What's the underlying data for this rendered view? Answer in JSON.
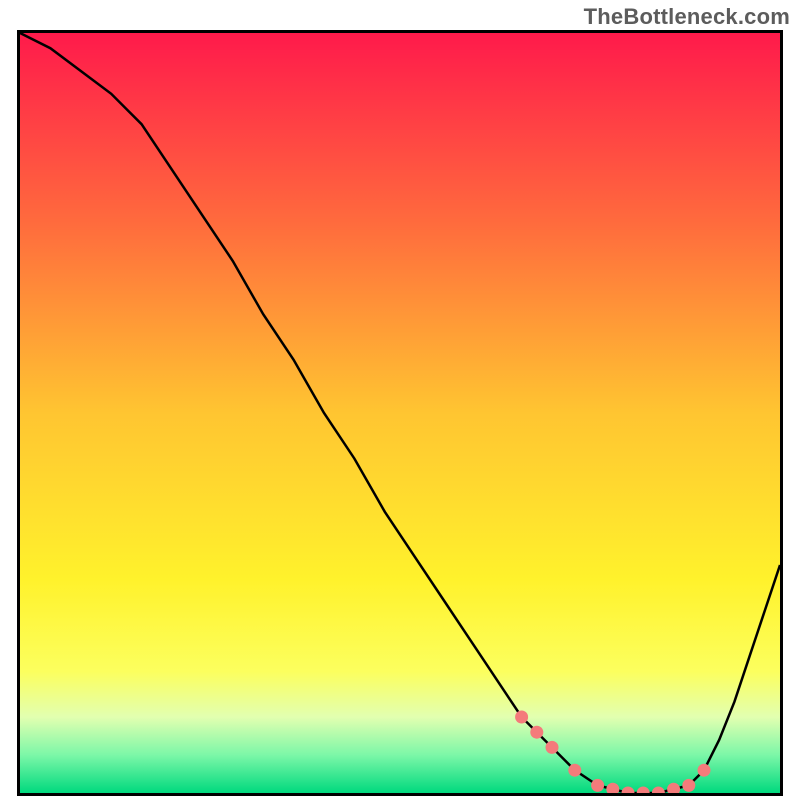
{
  "watermark": "TheBottleneck.com",
  "chart_data": {
    "type": "line",
    "title": "",
    "xlabel": "",
    "ylabel": "",
    "xlim": [
      0,
      100
    ],
    "ylim": [
      0,
      100
    ],
    "grid": false,
    "legend": false,
    "background": {
      "type": "vertical-gradient",
      "stops": [
        {
          "offset": 0.0,
          "color": "#ff1a4b"
        },
        {
          "offset": 0.25,
          "color": "#ff6b3d"
        },
        {
          "offset": 0.5,
          "color": "#ffc531"
        },
        {
          "offset": 0.72,
          "color": "#fff22c"
        },
        {
          "offset": 0.84,
          "color": "#fcff5e"
        },
        {
          "offset": 0.9,
          "color": "#e2ffb0"
        },
        {
          "offset": 0.95,
          "color": "#7cf7a8"
        },
        {
          "offset": 1.0,
          "color": "#00d97e"
        }
      ]
    },
    "series": [
      {
        "name": "bottleneck-curve",
        "color": "#000000",
        "x": [
          0,
          4,
          8,
          12,
          16,
          20,
          24,
          28,
          32,
          36,
          40,
          44,
          48,
          52,
          56,
          60,
          64,
          66,
          68,
          70,
          73,
          76,
          80,
          84,
          88,
          90,
          92,
          94,
          96,
          98,
          100
        ],
        "values": [
          100,
          98,
          95,
          92,
          88,
          82,
          76,
          70,
          63,
          57,
          50,
          44,
          37,
          31,
          25,
          19,
          13,
          10,
          8,
          6,
          3,
          1,
          0,
          0,
          1,
          3,
          7,
          12,
          18,
          24,
          30
        ]
      }
    ],
    "markers": {
      "name": "highlight-points",
      "color": "#f47b7b",
      "shape": "circle",
      "x": [
        66,
        68,
        70,
        73,
        76,
        78,
        80,
        82,
        84,
        86,
        88,
        90
      ],
      "values": [
        10,
        8,
        6,
        3,
        1,
        0.5,
        0,
        0,
        0,
        0.5,
        1,
        3
      ]
    }
  }
}
